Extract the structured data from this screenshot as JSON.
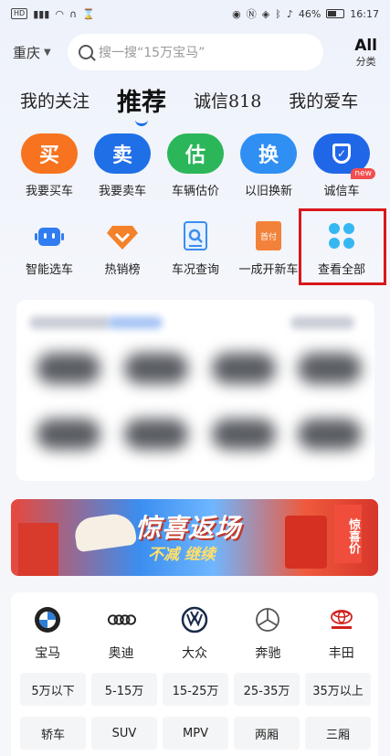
{
  "status_bar": {
    "left_chip": "HD",
    "network": "⁴ᴳ",
    "battery_text": "46%",
    "time": "16:17"
  },
  "header": {
    "city": "重庆",
    "search_placeholder": "搜一搜“15万宝马”",
    "all_big": "All",
    "all_small": "分类"
  },
  "tabs": [
    {
      "label": "我的关注"
    },
    {
      "label": "推荐"
    },
    {
      "label": "诚信818"
    },
    {
      "label": "我的爱车"
    }
  ],
  "primary_actions": [
    {
      "glyph": "买",
      "label": "我要买车",
      "color": "#f7731f"
    },
    {
      "glyph": "卖",
      "label": "我要卖车",
      "color": "#1f6fe6"
    },
    {
      "glyph": "估",
      "label": "车辆估价",
      "color": "#2bb65a"
    },
    {
      "glyph": "换",
      "label": "以旧换新",
      "color": "#2f8ff2"
    },
    {
      "glyph": "✓",
      "label": "诚信车",
      "color": "#2067e8",
      "badge": "new"
    }
  ],
  "secondary_actions": [
    {
      "label": "智能选车",
      "icon": "robot-icon",
      "color": "#2f7df0"
    },
    {
      "label": "热销榜",
      "icon": "diamond-icon",
      "color": "#f3822a"
    },
    {
      "label": "车况查询",
      "icon": "report-search-icon",
      "color": "#3a8df0"
    },
    {
      "label": "一成开新车",
      "icon": "down-payment-icon",
      "color": "#f2823a",
      "icon_text": "首付"
    },
    {
      "label": "查看全部",
      "icon": "clover-icon",
      "color": "#35b7f2"
    }
  ],
  "banner": {
    "title": "惊喜返场",
    "subtitle": "不减 继续",
    "sign_text": "惊喜价"
  },
  "brands": [
    {
      "name": "宝马",
      "icon": "bmw-logo-icon"
    },
    {
      "name": "奥迪",
      "icon": "audi-logo-icon"
    },
    {
      "name": "大众",
      "icon": "volkswagen-logo-icon"
    },
    {
      "name": "奔驰",
      "icon": "mercedes-logo-icon"
    },
    {
      "name": "丰田",
      "icon": "toyota-logo-icon"
    }
  ],
  "price_ranges": [
    "5万以下",
    "5-15万",
    "15-25万",
    "25-35万",
    "35万以上"
  ],
  "body_types": [
    "轿车",
    "SUV",
    "MPV",
    "两厢",
    "三厢"
  ]
}
